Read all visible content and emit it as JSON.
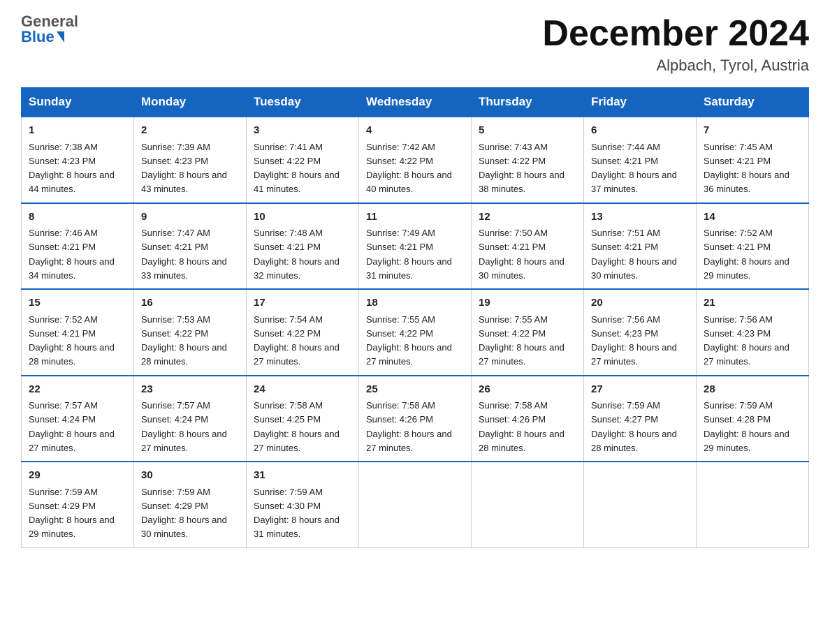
{
  "header": {
    "logo_general": "General",
    "logo_blue": "Blue",
    "month_title": "December 2024",
    "location": "Alpbach, Tyrol, Austria"
  },
  "days_of_week": [
    "Sunday",
    "Monday",
    "Tuesday",
    "Wednesday",
    "Thursday",
    "Friday",
    "Saturday"
  ],
  "weeks": [
    [
      {
        "day": "1",
        "sunrise": "7:38 AM",
        "sunset": "4:23 PM",
        "daylight": "8 hours and 44 minutes."
      },
      {
        "day": "2",
        "sunrise": "7:39 AM",
        "sunset": "4:23 PM",
        "daylight": "8 hours and 43 minutes."
      },
      {
        "day": "3",
        "sunrise": "7:41 AM",
        "sunset": "4:22 PM",
        "daylight": "8 hours and 41 minutes."
      },
      {
        "day": "4",
        "sunrise": "7:42 AM",
        "sunset": "4:22 PM",
        "daylight": "8 hours and 40 minutes."
      },
      {
        "day": "5",
        "sunrise": "7:43 AM",
        "sunset": "4:22 PM",
        "daylight": "8 hours and 38 minutes."
      },
      {
        "day": "6",
        "sunrise": "7:44 AM",
        "sunset": "4:21 PM",
        "daylight": "8 hours and 37 minutes."
      },
      {
        "day": "7",
        "sunrise": "7:45 AM",
        "sunset": "4:21 PM",
        "daylight": "8 hours and 36 minutes."
      }
    ],
    [
      {
        "day": "8",
        "sunrise": "7:46 AM",
        "sunset": "4:21 PM",
        "daylight": "8 hours and 34 minutes."
      },
      {
        "day": "9",
        "sunrise": "7:47 AM",
        "sunset": "4:21 PM",
        "daylight": "8 hours and 33 minutes."
      },
      {
        "day": "10",
        "sunrise": "7:48 AM",
        "sunset": "4:21 PM",
        "daylight": "8 hours and 32 minutes."
      },
      {
        "day": "11",
        "sunrise": "7:49 AM",
        "sunset": "4:21 PM",
        "daylight": "8 hours and 31 minutes."
      },
      {
        "day": "12",
        "sunrise": "7:50 AM",
        "sunset": "4:21 PM",
        "daylight": "8 hours and 30 minutes."
      },
      {
        "day": "13",
        "sunrise": "7:51 AM",
        "sunset": "4:21 PM",
        "daylight": "8 hours and 30 minutes."
      },
      {
        "day": "14",
        "sunrise": "7:52 AM",
        "sunset": "4:21 PM",
        "daylight": "8 hours and 29 minutes."
      }
    ],
    [
      {
        "day": "15",
        "sunrise": "7:52 AM",
        "sunset": "4:21 PM",
        "daylight": "8 hours and 28 minutes."
      },
      {
        "day": "16",
        "sunrise": "7:53 AM",
        "sunset": "4:22 PM",
        "daylight": "8 hours and 28 minutes."
      },
      {
        "day": "17",
        "sunrise": "7:54 AM",
        "sunset": "4:22 PM",
        "daylight": "8 hours and 27 minutes."
      },
      {
        "day": "18",
        "sunrise": "7:55 AM",
        "sunset": "4:22 PM",
        "daylight": "8 hours and 27 minutes."
      },
      {
        "day": "19",
        "sunrise": "7:55 AM",
        "sunset": "4:22 PM",
        "daylight": "8 hours and 27 minutes."
      },
      {
        "day": "20",
        "sunrise": "7:56 AM",
        "sunset": "4:23 PM",
        "daylight": "8 hours and 27 minutes."
      },
      {
        "day": "21",
        "sunrise": "7:56 AM",
        "sunset": "4:23 PM",
        "daylight": "8 hours and 27 minutes."
      }
    ],
    [
      {
        "day": "22",
        "sunrise": "7:57 AM",
        "sunset": "4:24 PM",
        "daylight": "8 hours and 27 minutes."
      },
      {
        "day": "23",
        "sunrise": "7:57 AM",
        "sunset": "4:24 PM",
        "daylight": "8 hours and 27 minutes."
      },
      {
        "day": "24",
        "sunrise": "7:58 AM",
        "sunset": "4:25 PM",
        "daylight": "8 hours and 27 minutes."
      },
      {
        "day": "25",
        "sunrise": "7:58 AM",
        "sunset": "4:26 PM",
        "daylight": "8 hours and 27 minutes."
      },
      {
        "day": "26",
        "sunrise": "7:58 AM",
        "sunset": "4:26 PM",
        "daylight": "8 hours and 28 minutes."
      },
      {
        "day": "27",
        "sunrise": "7:59 AM",
        "sunset": "4:27 PM",
        "daylight": "8 hours and 28 minutes."
      },
      {
        "day": "28",
        "sunrise": "7:59 AM",
        "sunset": "4:28 PM",
        "daylight": "8 hours and 29 minutes."
      }
    ],
    [
      {
        "day": "29",
        "sunrise": "7:59 AM",
        "sunset": "4:29 PM",
        "daylight": "8 hours and 29 minutes."
      },
      {
        "day": "30",
        "sunrise": "7:59 AM",
        "sunset": "4:29 PM",
        "daylight": "8 hours and 30 minutes."
      },
      {
        "day": "31",
        "sunrise": "7:59 AM",
        "sunset": "4:30 PM",
        "daylight": "8 hours and 31 minutes."
      },
      null,
      null,
      null,
      null
    ]
  ]
}
